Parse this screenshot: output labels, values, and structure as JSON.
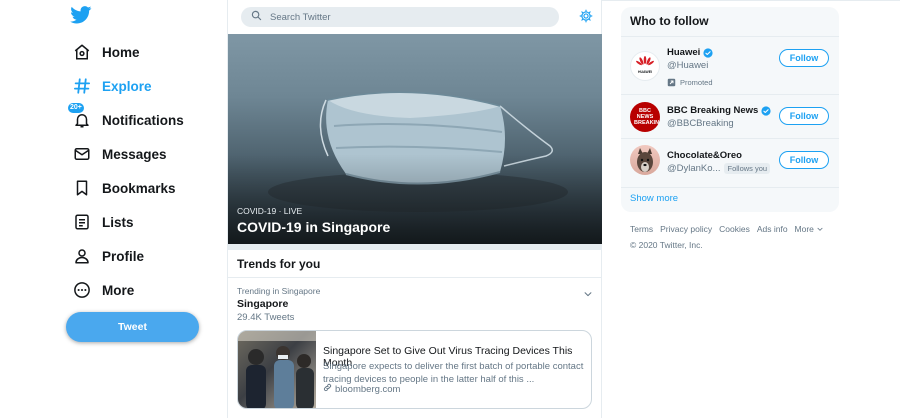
{
  "nav": {
    "items": [
      {
        "label": "Home",
        "icon": "home-icon"
      },
      {
        "label": "Explore",
        "icon": "hashtag-icon",
        "active": true
      },
      {
        "label": "Notifications",
        "icon": "bell-icon",
        "badge": "20+"
      },
      {
        "label": "Messages",
        "icon": "envelope-icon"
      },
      {
        "label": "Bookmarks",
        "icon": "bookmark-icon"
      },
      {
        "label": "Lists",
        "icon": "list-icon"
      },
      {
        "label": "Profile",
        "icon": "person-icon"
      },
      {
        "label": "More",
        "icon": "more-circle-icon"
      }
    ],
    "tweet_label": "Tweet"
  },
  "search": {
    "placeholder": "Search Twitter"
  },
  "hero": {
    "meta": "COVID-19 · LIVE",
    "title": "COVID-19 in Singapore"
  },
  "trends": {
    "heading": "Trends for you",
    "item": {
      "context": "Trending in Singapore",
      "name": "Singapore",
      "count": "29.4K Tweets"
    },
    "card": {
      "title": "Singapore Set to Give Out Virus Tracing Devices This Month",
      "description": "Singapore expects to deliver the first batch of portable contact tracing devices to people in the latter half of this ...",
      "link": "bloomberg.com"
    }
  },
  "who_to_follow": {
    "title": "Who to follow",
    "accounts": [
      {
        "name": "Huawei",
        "handle": "@Huawei",
        "verified": true,
        "promoted": "Promoted",
        "button": "Follow",
        "avatar_text": "HUAWEI"
      },
      {
        "name": "BBC Breaking News",
        "handle": "@BBCBreaking",
        "verified": true,
        "button": "Follow",
        "avatar_text": "BBC NEWS BREAKING"
      },
      {
        "name": "Chocolate&Oreo",
        "handle": "@DylanKo...",
        "follows_you": "Follows you",
        "button": "Follow"
      }
    ],
    "show_more": "Show more"
  },
  "footer": {
    "links": [
      "Terms",
      "Privacy policy",
      "Cookies",
      "Ads info",
      "More"
    ],
    "copyright": "© 2020 Twitter, Inc."
  },
  "colors": {
    "accent": "#1da1f2",
    "tweet_button": "#4aa8ee",
    "text": "#14171a",
    "muted": "#657786",
    "panel": "#f5f8fa"
  }
}
